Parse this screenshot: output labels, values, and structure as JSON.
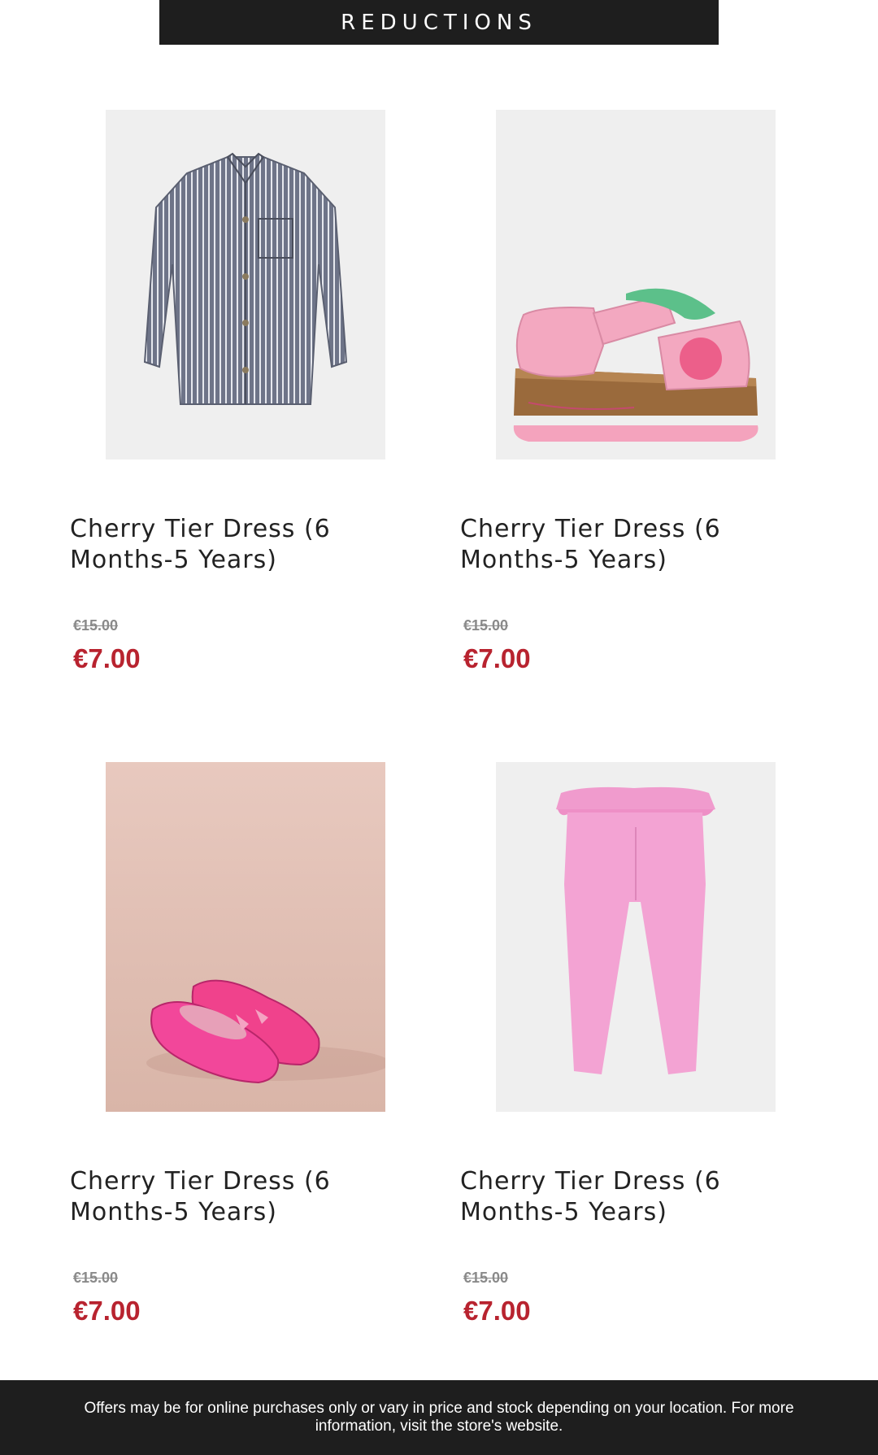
{
  "header": {
    "title": "REDUCTIONS"
  },
  "products": [
    {
      "name": "Cherry Tier Dress (6 Months-5 Years)",
      "old_price": "€15.00",
      "new_price": "€7.00",
      "image": "striped-shirt-image"
    },
    {
      "name": "Cherry Tier Dress (6 Months-5 Years)",
      "old_price": "€15.00",
      "new_price": "€7.00",
      "image": "pink-sandal-image"
    },
    {
      "name": "Cherry Tier Dress (6 Months-5 Years)",
      "old_price": "€15.00",
      "new_price": "€7.00",
      "image": "pink-ballet-flats-image"
    },
    {
      "name": "Cherry Tier Dress (6 Months-5 Years)",
      "old_price": "€15.00",
      "new_price": "€7.00",
      "image": "pink-leggings-image"
    }
  ],
  "footer": {
    "text": "Offers may be for online purchases only or vary in price and stock depending on your location. For more information, visit the store's website."
  },
  "colors": {
    "header_bg": "#1e1e1e",
    "sale_red": "#b8232f",
    "old_price_grey": "#8a8a8a"
  }
}
